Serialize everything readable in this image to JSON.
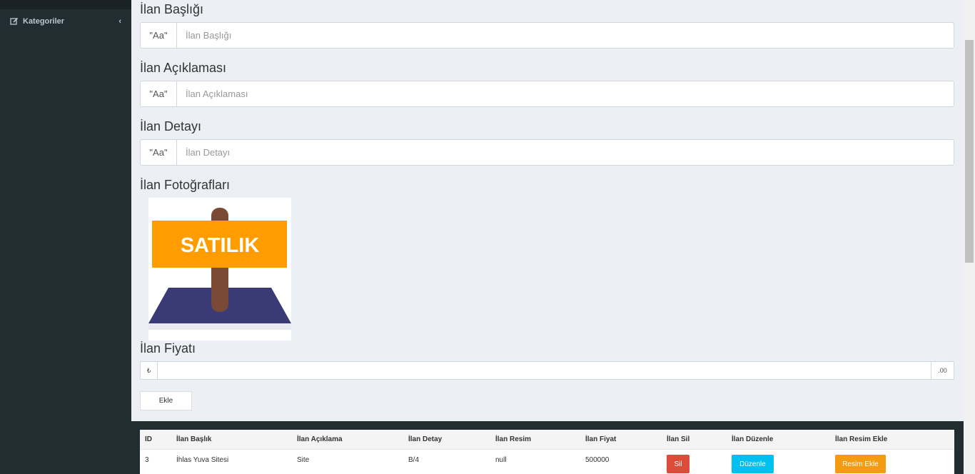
{
  "sidebar": {
    "items": [
      {
        "label": "Kategoriler",
        "icon": "edit-icon"
      }
    ]
  },
  "form": {
    "title_label": "İlan Başlığı",
    "title_addon": "\"Aa\"",
    "title_placeholder": "İlan Başlığı",
    "description_label": "İlan Açıklaması",
    "description_addon": "\"Aa\"",
    "description_placeholder": "İlan Açıklaması",
    "detail_label": "İlan Detayı",
    "detail_addon": "\"Aa\"",
    "detail_placeholder": "İlan Detayı",
    "photos_label": "İlan Fotoğrafları",
    "photo_sign_text": "SATILIK",
    "price_label": "İlan Fiyatı",
    "price_currency": "₺",
    "price_suffix": ".00",
    "submit_label": "Ekle"
  },
  "table": {
    "headers": [
      "ID",
      "İlan Başlık",
      "İlan Açıklama",
      "İlan Detay",
      "İlan Resim",
      "İlan Fiyat",
      "İlan Sil",
      "İlan Düzenle",
      "İlan Resim Ekle"
    ],
    "rows": [
      {
        "id": "3",
        "title": "İhlas Yuva Sitesi",
        "description": "Site",
        "detail": "B/4",
        "image": "null",
        "price": "500000",
        "delete_label": "Sil",
        "edit_label": "Düzenle",
        "add_image_label": "Resim Ekle"
      }
    ]
  },
  "colors": {
    "sidebar_bg": "#222d32",
    "content_bg": "#ecf0f5",
    "danger": "#dd4b39",
    "info": "#00c0ef",
    "warning": "#f39c12",
    "sign_orange": "#ff9c00",
    "sign_platform": "#3a3a77",
    "sign_post": "#7a4a36"
  }
}
